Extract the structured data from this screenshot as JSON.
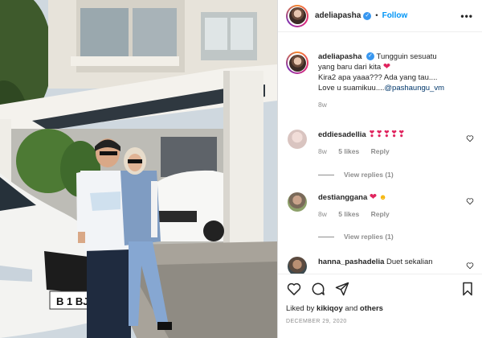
{
  "post": {
    "username": "adeliapasha",
    "follow_label": "Follow",
    "more_label": "•••",
    "dot": "•",
    "verified_mark": "✓"
  },
  "caption": {
    "username": "adeliapasha",
    "line1": "Tungguin sesuatu",
    "line2": "yang baru dari kita",
    "line3": "Kira2 apa yaaa??? Ada yang tau....",
    "line4": "Love u suamikuu....",
    "mention": "@pashaungu_vm",
    "time": "8w"
  },
  "comments": [
    {
      "username": "eddiesadellia",
      "text": "",
      "time": "8w",
      "likes": "5 likes",
      "reply": "Reply",
      "view_replies": "View replies (1)"
    },
    {
      "username": "destianggana",
      "text": "",
      "time": "8w",
      "likes": "5 likes",
      "reply": "Reply",
      "view_replies": "View replies (1)"
    },
    {
      "username": "hanna_pashadelia",
      "text": "Duet sekalian"
    }
  ],
  "actions": {
    "liked_by_prefix": "Liked by",
    "liked_by_user": "kikiqoy",
    "liked_by_and": "and",
    "liked_by_others": "others",
    "date": "DECEMBER 29, 2020",
    "icons": [
      "heart-icon",
      "comment-icon",
      "share-icon",
      "bookmark-icon"
    ]
  },
  "colors": {
    "link": "#0095f6",
    "heart": "#e0245e",
    "muted": "#8e8e8e"
  }
}
